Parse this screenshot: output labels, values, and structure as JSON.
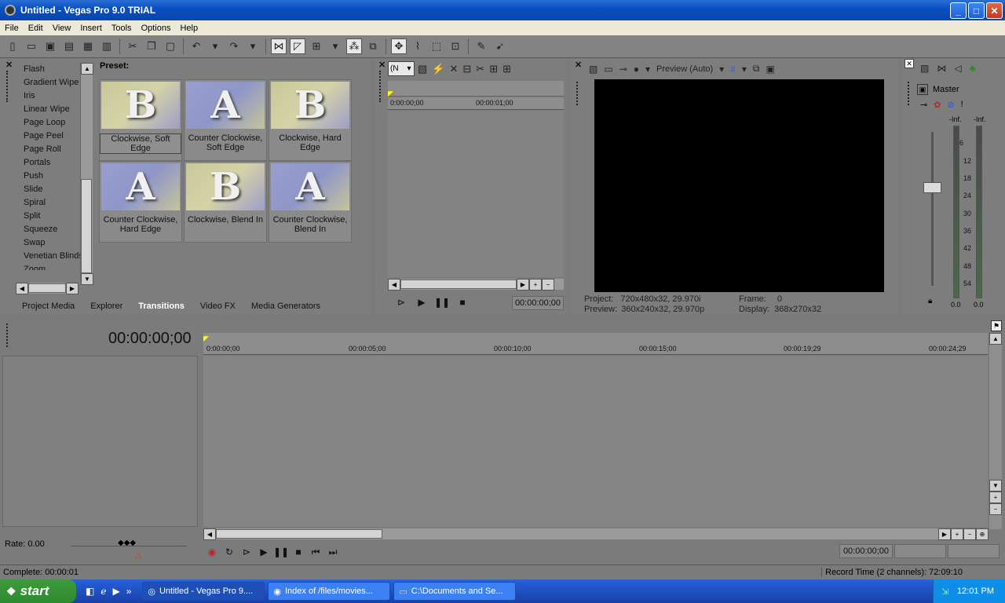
{
  "window": {
    "title": "Untitled - Vegas Pro 9.0 TRIAL",
    "minimize": "_",
    "maximize": "□",
    "close": "✕"
  },
  "menu": [
    "File",
    "Edit",
    "View",
    "Insert",
    "Tools",
    "Options",
    "Help"
  ],
  "transitions": {
    "list": [
      "Flash",
      "Gradient Wipe",
      "Iris",
      "Linear Wipe",
      "Page Loop",
      "Page Peel",
      "Page Roll",
      "Portals",
      "Push",
      "Slide",
      "Spiral",
      "Split",
      "Squeeze",
      "Swap",
      "Venetian Blinds",
      "Zoom"
    ],
    "preset_label": "Preset:",
    "presets": [
      {
        "label": "Clockwise, Soft Edge",
        "glyph": "B",
        "selected": true
      },
      {
        "label": "Counter Clockwise, Soft Edge",
        "glyph": "A",
        "selected": false
      },
      {
        "label": "Clockwise, Hard Edge",
        "glyph": "B",
        "selected": false
      },
      {
        "label": "Counter Clockwise, Hard Edge",
        "glyph": "A",
        "selected": false
      },
      {
        "label": "Clockwise, Blend In",
        "glyph": "B",
        "selected": false
      },
      {
        "label": "Counter Clockwise, Blend In",
        "glyph": "A",
        "selected": false
      }
    ]
  },
  "tabs": [
    "Project Media",
    "Explorer",
    "Transitions",
    "Video FX",
    "Media Generators"
  ],
  "active_tab": "Transitions",
  "trimmer": {
    "dropdown": "(N",
    "ruler_start": "0:00:00;00",
    "ruler_mark": "00:00:01;00",
    "timecode": "00:00:00;00"
  },
  "preview": {
    "mode": "Preview (Auto)",
    "project_label": "Project:",
    "project_value": "720x480x32, 29.970i",
    "preview_label": "Preview:",
    "preview_value": "360x240x32, 29.970p",
    "frame_label": "Frame:",
    "frame_value": "0",
    "display_label": "Display:",
    "display_value": "368x270x32"
  },
  "mixer": {
    "master": "Master",
    "left_peak": "-Inf.",
    "right_peak": "-Inf.",
    "scale": [
      "6",
      "12",
      "18",
      "24",
      "30",
      "36",
      "42",
      "48",
      "54"
    ],
    "left_level": "0.0",
    "right_level": "0.0"
  },
  "timeline": {
    "timecode": "00:00:00;00",
    "ruler": [
      "0:00:00;00",
      "00:00:05;00",
      "00:00:10;00",
      "00:00:15;00",
      "00:00:19;29",
      "00:00:24;29"
    ],
    "rate": "Rate: 0.00",
    "transport_timecode": "00:00:00;00"
  },
  "status": {
    "complete": "Complete: 00:00:01",
    "record_time": "Record Time (2 channels): 72:09:10"
  },
  "taskbar": {
    "start": "start",
    "items": [
      "Untitled - Vegas Pro 9....",
      "Index of /files/movies...",
      "C:\\Documents and Se..."
    ],
    "clock": "12:01 PM"
  }
}
